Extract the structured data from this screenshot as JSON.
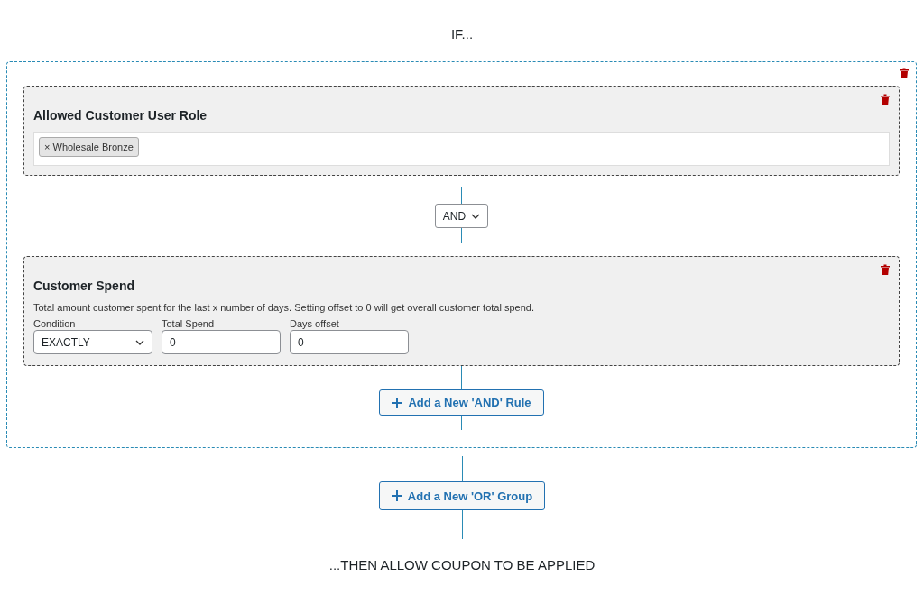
{
  "heading": "IF...",
  "groups": [
    {
      "rules": [
        {
          "kind": "roles",
          "title": "Allowed Customer User Role",
          "tags": [
            {
              "remove": "×",
              "label": "Wholesale Bronze"
            }
          ]
        },
        {
          "kind": "spend",
          "title": "Customer Spend",
          "description": "Total amount customer spent for the last x number of days. Setting offset to 0 will get overall customer total spend.",
          "fields": [
            {
              "kind": "select",
              "label": "Condition",
              "value": "EXACTLY"
            },
            {
              "kind": "input",
              "label": "Total Spend",
              "value": "0"
            },
            {
              "kind": "input",
              "label": "Days offset",
              "value": "0"
            }
          ]
        }
      ],
      "logic": [
        "AND"
      ],
      "add_rule_button": "Add a New 'AND' Rule"
    }
  ],
  "add_group_button": "Add a New 'OR' Group",
  "footer": "...THEN ALLOW COUPON TO BE APPLIED"
}
